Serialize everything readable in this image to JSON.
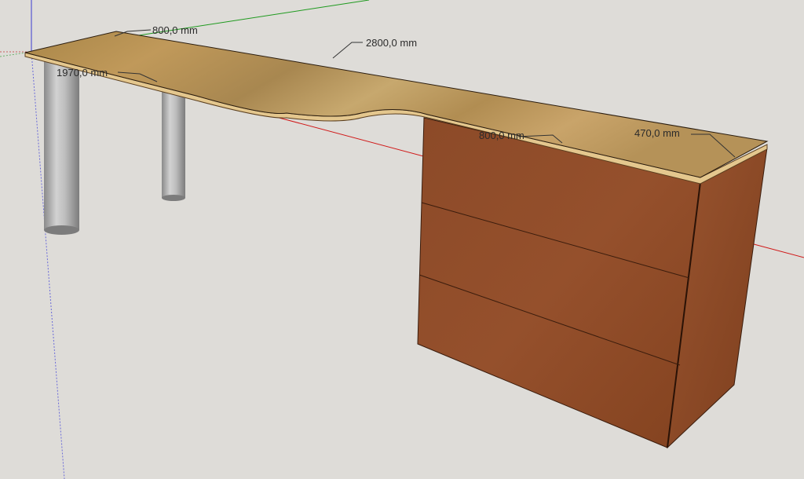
{
  "dimensions": {
    "depth_label": "800,0 mm",
    "length_label": "2800,0 mm",
    "left_span_label": "1970,0 mm",
    "cabinet_width_label": "800,0 mm",
    "cabinet_depth_label": "470,0 mm"
  },
  "colors": {
    "background": "#dedcd8",
    "red_axis": "#d01818",
    "green_axis": "#1e9a1e",
    "blue_axis": "#3a3ad0",
    "desktop_wood": "#b08a4e",
    "desktop_edge": "#e8c88a",
    "cabinet_wood": "#8a4524",
    "leg_metal": "#a8a8a8"
  }
}
